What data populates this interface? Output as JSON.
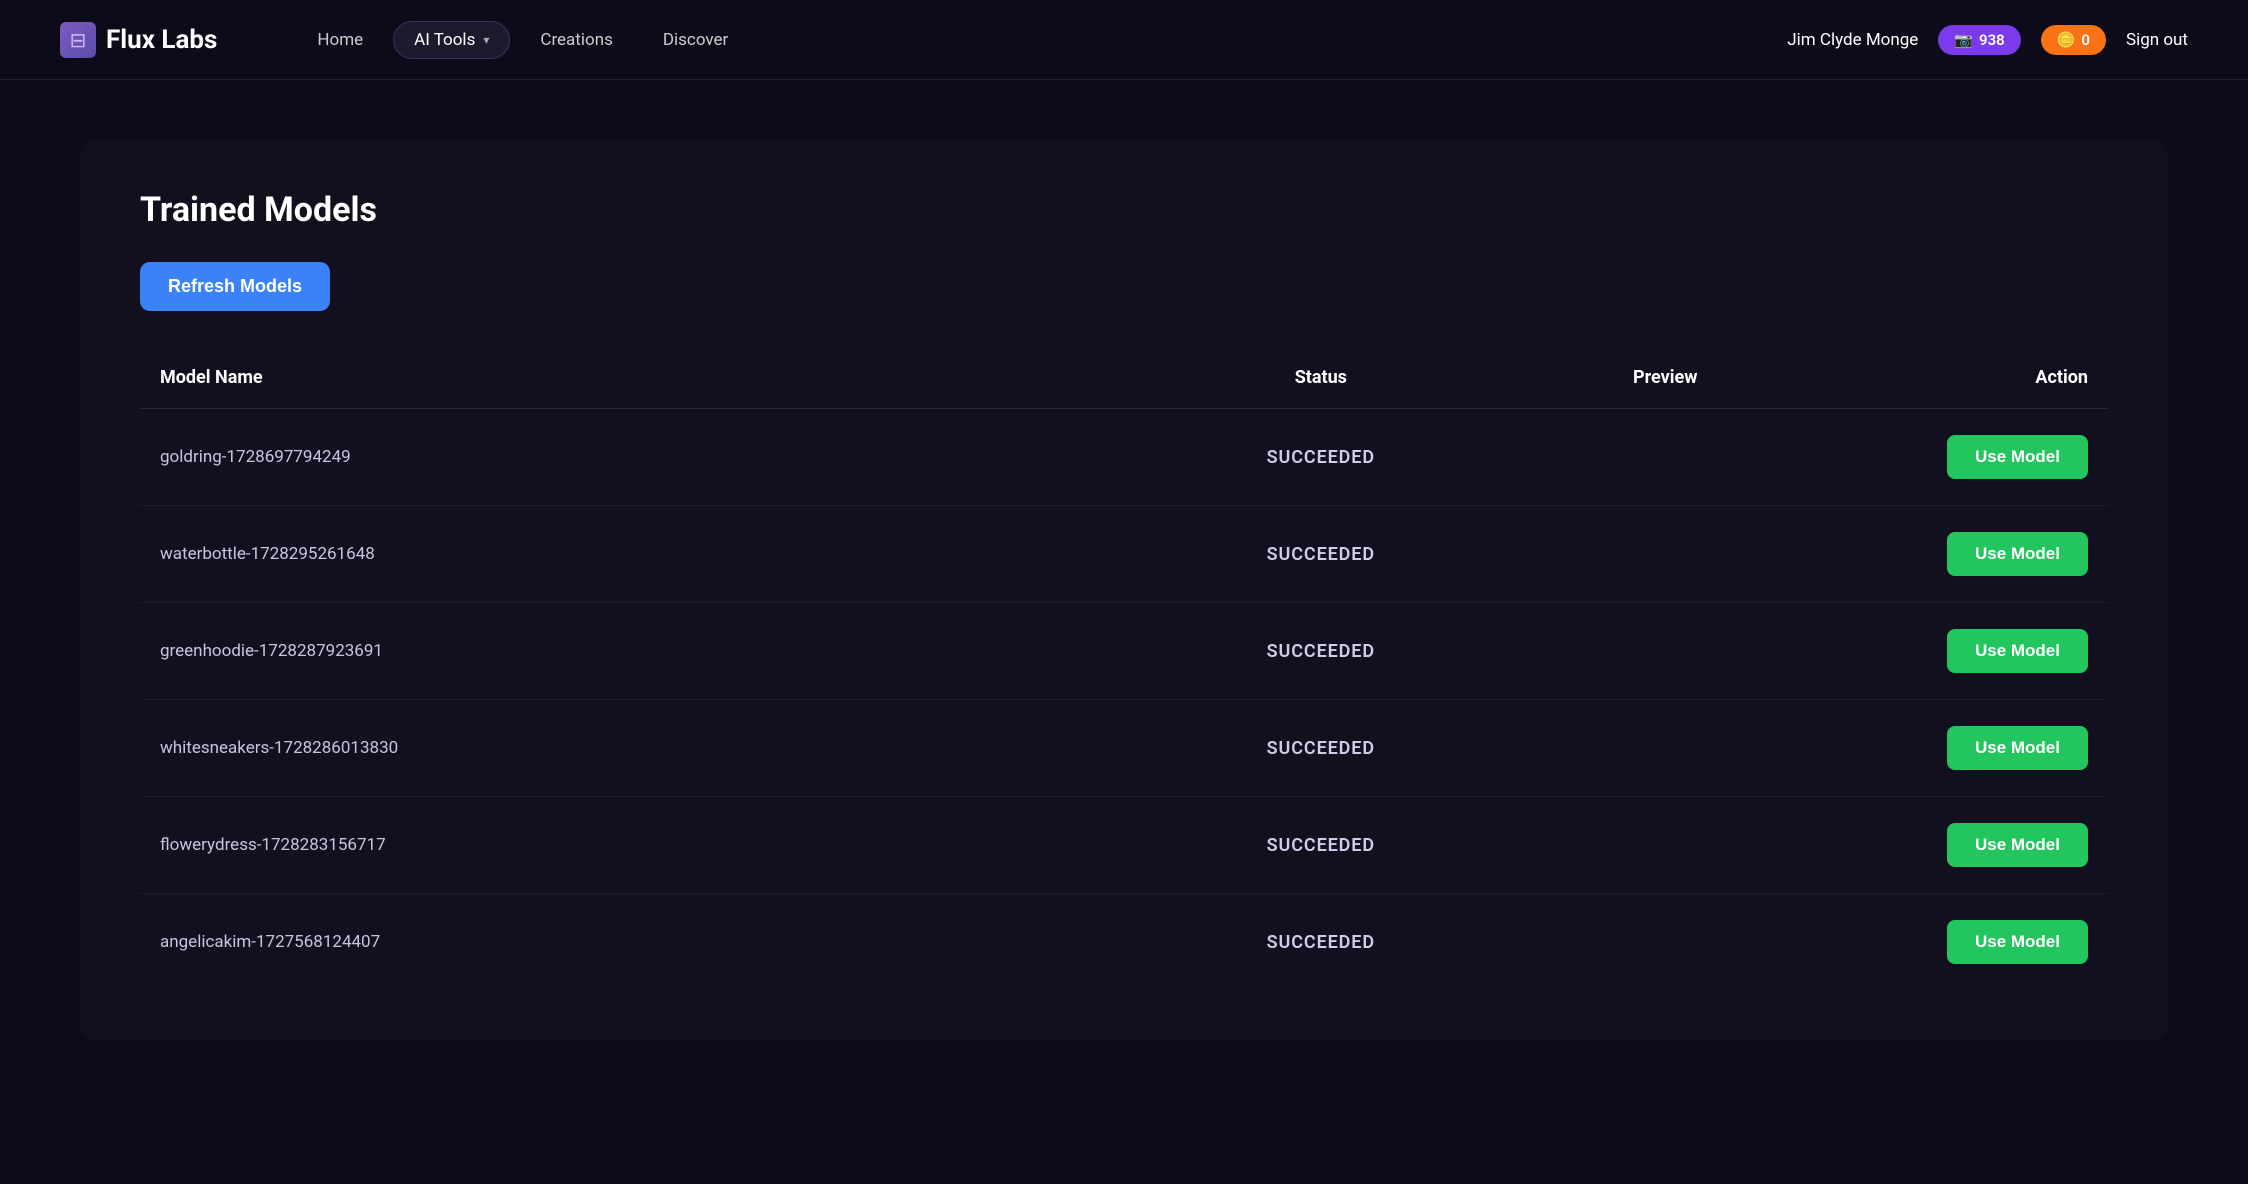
{
  "header": {
    "logo_text": "Flux Labs",
    "logo_icon": "⊟",
    "nav": {
      "home_label": "Home",
      "ai_tools_label": "AI Tools",
      "creations_label": "Creations",
      "discover_label": "Discover"
    },
    "user": {
      "name": "Jim Clyde Monge",
      "credits_purple": "938",
      "credits_orange": "0",
      "sign_out_label": "Sign out"
    }
  },
  "main": {
    "title": "Trained Models",
    "refresh_button": "Refresh Models",
    "table": {
      "columns": [
        "Model Name",
        "Status",
        "Preview",
        "Action"
      ],
      "use_model_label": "Use Model",
      "rows": [
        {
          "model_name": "goldring-1728697794249",
          "status": "SUCCEEDED"
        },
        {
          "model_name": "waterbottle-1728295261648",
          "status": "SUCCEEDED"
        },
        {
          "model_name": "greenhoodie-1728287923691",
          "status": "SUCCEEDED"
        },
        {
          "model_name": "whitesneakers-1728286013830",
          "status": "SUCCEEDED"
        },
        {
          "model_name": "flowerydress-1728283156717",
          "status": "SUCCEEDED"
        },
        {
          "model_name": "angelicakim-1727568124407",
          "status": "SUCCEEDED"
        }
      ]
    }
  }
}
